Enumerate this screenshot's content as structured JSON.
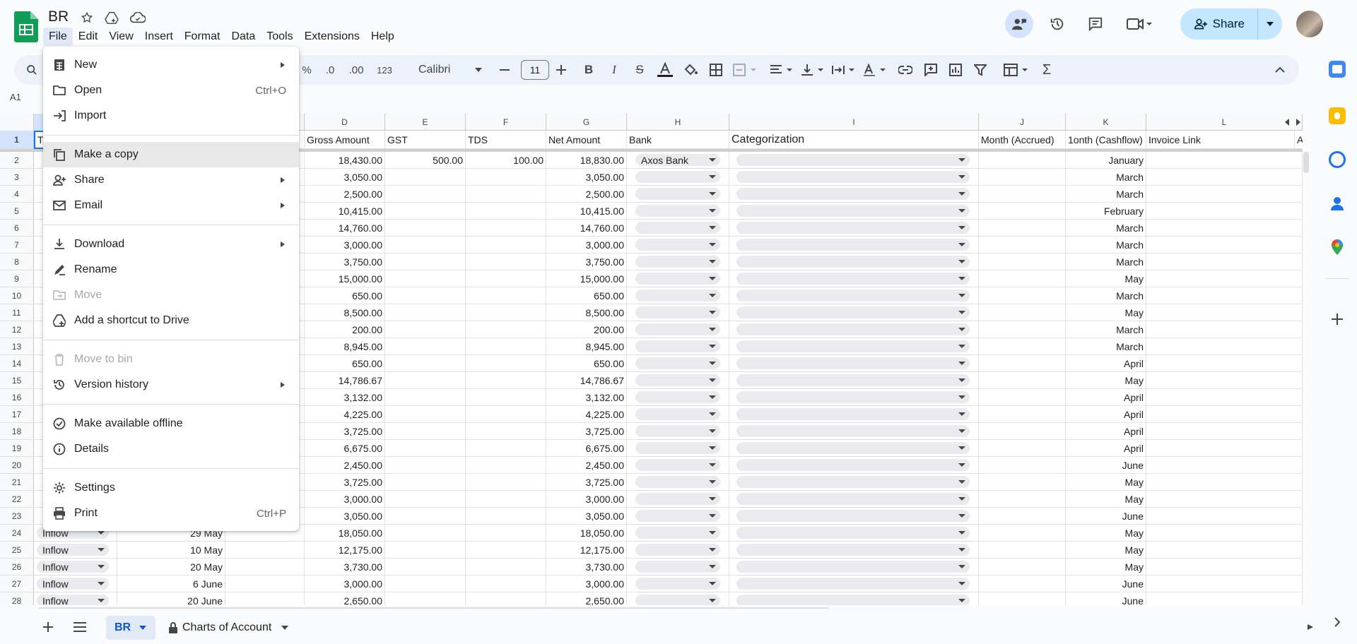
{
  "header": {
    "doc_title": "BR",
    "menus": [
      "File",
      "Edit",
      "View",
      "Insert",
      "Format",
      "Data",
      "Tools",
      "Extensions",
      "Help"
    ],
    "share_label": "Share"
  },
  "toolbar": {
    "percent": "%",
    "dec_decrease": ".0",
    "dec_increase": ".00",
    "num_format": "123",
    "font": "Calibri",
    "font_size": "11"
  },
  "formula_bar": {
    "name_box": "A1"
  },
  "columns": [
    "D",
    "E",
    "F",
    "G",
    "H",
    "I",
    "J",
    "K",
    "L"
  ],
  "header_row": {
    "row_num": "1",
    "a": "T",
    "d": "Gross Amount",
    "e": "GST",
    "f": "TDS",
    "g": "Net Amount",
    "h": "Bank",
    "i": "Categorization",
    "j": "Month (Accrued)",
    "k": "1onth (Cashflow)",
    "l": "Invoice Link",
    "m": "A"
  },
  "rows": [
    {
      "n": "2",
      "d": "18,430.00",
      "e": "500.00",
      "f": "100.00",
      "g": "18,830.00",
      "bank": "Axos Bank",
      "k": "January"
    },
    {
      "n": "3",
      "d": "3,050.00",
      "g": "3,050.00",
      "k": "March"
    },
    {
      "n": "4",
      "d": "2,500.00",
      "g": "2,500.00",
      "k": "March"
    },
    {
      "n": "5",
      "d": "10,415.00",
      "g": "10,415.00",
      "k": "February"
    },
    {
      "n": "6",
      "d": "14,760.00",
      "g": "14,760.00",
      "k": "March"
    },
    {
      "n": "7",
      "d": "3,000.00",
      "g": "3,000.00",
      "k": "March"
    },
    {
      "n": "8",
      "d": "3,750.00",
      "g": "3,750.00",
      "k": "March"
    },
    {
      "n": "9",
      "d": "15,000.00",
      "g": "15,000.00",
      "k": "May"
    },
    {
      "n": "10",
      "d": "650.00",
      "g": "650.00",
      "k": "March"
    },
    {
      "n": "11",
      "d": "8,500.00",
      "g": "8,500.00",
      "k": "May"
    },
    {
      "n": "12",
      "d": "200.00",
      "g": "200.00",
      "k": "March"
    },
    {
      "n": "13",
      "d": "8,945.00",
      "g": "8,945.00",
      "k": "March"
    },
    {
      "n": "14",
      "d": "650.00",
      "g": "650.00",
      "k": "April"
    },
    {
      "n": "15",
      "d": "14,786.67",
      "g": "14,786.67",
      "k": "May"
    },
    {
      "n": "16",
      "d": "3,132.00",
      "g": "3,132.00",
      "k": "April"
    },
    {
      "n": "17",
      "d": "4,225.00",
      "g": "4,225.00",
      "k": "April"
    },
    {
      "n": "18",
      "d": "3,725.00",
      "g": "3,725.00",
      "k": "April"
    },
    {
      "n": "19",
      "d": "6,675.00",
      "g": "6,675.00",
      "k": "April"
    },
    {
      "n": "20",
      "d": "2,450.00",
      "g": "2,450.00",
      "k": "June"
    },
    {
      "n": "21",
      "d": "3,725.00",
      "g": "3,725.00",
      "k": "May"
    },
    {
      "n": "22",
      "d": "3,000.00",
      "g": "3,000.00",
      "k": "May"
    },
    {
      "n": "23",
      "d": "3,050.00",
      "g": "3,050.00",
      "k": "June"
    },
    {
      "n": "24",
      "a": "Inflow",
      "b": "29 May",
      "d": "18,050.00",
      "g": "18,050.00",
      "k": "May"
    },
    {
      "n": "25",
      "a": "Inflow",
      "b": "10 May",
      "d": "12,175.00",
      "g": "12,175.00",
      "k": "May"
    },
    {
      "n": "26",
      "a": "Inflow",
      "b": "20 May",
      "d": "3,730.00",
      "g": "3,730.00",
      "k": "May"
    },
    {
      "n": "27",
      "a": "Inflow",
      "b": "6 June",
      "d": "3,000.00",
      "g": "3,000.00",
      "k": "June"
    },
    {
      "n": "28",
      "a": "Inflow",
      "b": "20 June",
      "d": "2,650.00",
      "g": "2,650.00",
      "k": "June"
    }
  ],
  "file_menu": {
    "items": [
      {
        "label": "New",
        "icon": "new-sheet-icon",
        "submenu": true
      },
      {
        "label": "Open",
        "icon": "folder-icon",
        "shortcut": "Ctrl+O"
      },
      {
        "label": "Import",
        "icon": "import-icon"
      },
      {
        "label": "Make a copy",
        "icon": "copy-icon"
      },
      {
        "label": "Share",
        "icon": "person-add-icon",
        "submenu": true
      },
      {
        "label": "Email",
        "icon": "email-icon",
        "submenu": true
      },
      {
        "label": "Download",
        "icon": "download-icon",
        "submenu": true
      },
      {
        "label": "Rename",
        "icon": "rename-icon"
      },
      {
        "label": "Move",
        "icon": "move-icon",
        "disabled": true
      },
      {
        "label": "Add a shortcut to Drive",
        "icon": "drive-shortcut-icon"
      },
      {
        "label": "Move to bin",
        "icon": "bin-icon",
        "disabled": true
      },
      {
        "label": "Version history",
        "icon": "history-icon",
        "submenu": true
      },
      {
        "label": "Make available offline",
        "icon": "offline-icon"
      },
      {
        "label": "Details",
        "icon": "info-icon"
      },
      {
        "label": "Settings",
        "icon": "gear-icon"
      },
      {
        "label": "Print",
        "icon": "print-icon",
        "shortcut": "Ctrl+P"
      }
    ]
  },
  "sheets": {
    "active": "BR",
    "other": "Charts of Account"
  },
  "colors": {
    "accent": "#0b57d0",
    "share_bg": "#c2e7ff",
    "sheets_green": "#0f9d58"
  }
}
